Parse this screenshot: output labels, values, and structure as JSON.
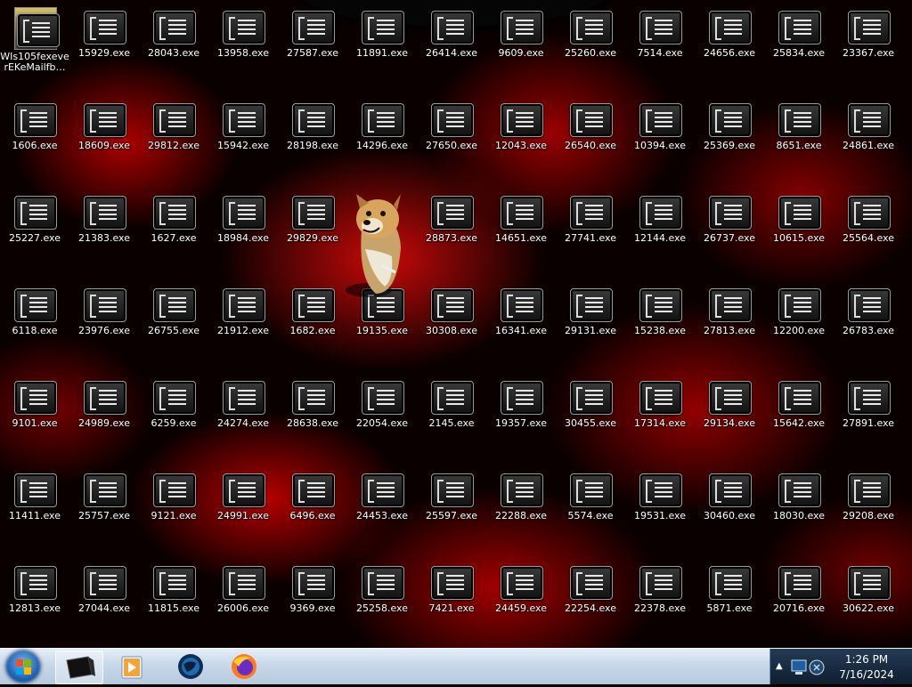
{
  "desktop": {
    "icons": [
      {
        "label": "WIs105fexeve\nrEKeMailfb…"
      },
      {
        "label": "15929.exe"
      },
      {
        "label": "28043.exe"
      },
      {
        "label": "13958.exe"
      },
      {
        "label": "27587.exe"
      },
      {
        "label": "11891.exe"
      },
      {
        "label": "26414.exe"
      },
      {
        "label": "9609.exe"
      },
      {
        "label": "25260.exe"
      },
      {
        "label": "7514.exe"
      },
      {
        "label": "24656.exe"
      },
      {
        "label": "25834.exe"
      },
      {
        "label": "23367.exe"
      },
      {
        "label": "1606.exe"
      },
      {
        "label": "18609.exe"
      },
      {
        "label": "29812.exe"
      },
      {
        "label": "15942.exe"
      },
      {
        "label": "28198.exe"
      },
      {
        "label": "14296.exe"
      },
      {
        "label": "27650.exe"
      },
      {
        "label": "12043.exe"
      },
      {
        "label": "26540.exe"
      },
      {
        "label": "10394.exe"
      },
      {
        "label": "25369.exe"
      },
      {
        "label": "8651.exe"
      },
      {
        "label": "24861.exe"
      },
      {
        "label": "25227.exe"
      },
      {
        "label": "21383.exe"
      },
      {
        "label": "1627.exe"
      },
      {
        "label": "18984.exe"
      },
      {
        "label": "29829.exe"
      },
      {
        "label": ""
      },
      {
        "label": "28873.exe"
      },
      {
        "label": "14651.exe"
      },
      {
        "label": "27741.exe"
      },
      {
        "label": "12144.exe"
      },
      {
        "label": "26737.exe"
      },
      {
        "label": "10615.exe"
      },
      {
        "label": "25564.exe"
      },
      {
        "label": "6118.exe"
      },
      {
        "label": "23976.exe"
      },
      {
        "label": "26755.exe"
      },
      {
        "label": "21912.exe"
      },
      {
        "label": "1682.exe"
      },
      {
        "label": "19135.exe"
      },
      {
        "label": "30308.exe"
      },
      {
        "label": "16341.exe"
      },
      {
        "label": "29131.exe"
      },
      {
        "label": "15238.exe"
      },
      {
        "label": "27813.exe"
      },
      {
        "label": "12200.exe"
      },
      {
        "label": "26783.exe"
      },
      {
        "label": "9101.exe"
      },
      {
        "label": "24989.exe"
      },
      {
        "label": "6259.exe"
      },
      {
        "label": "24274.exe"
      },
      {
        "label": "28638.exe"
      },
      {
        "label": "22054.exe"
      },
      {
        "label": "2145.exe"
      },
      {
        "label": "19357.exe"
      },
      {
        "label": "30455.exe"
      },
      {
        "label": "17314.exe"
      },
      {
        "label": "29134.exe"
      },
      {
        "label": "15642.exe"
      },
      {
        "label": "27891.exe"
      },
      {
        "label": "11411.exe"
      },
      {
        "label": "25757.exe"
      },
      {
        "label": "9121.exe"
      },
      {
        "label": "24991.exe"
      },
      {
        "label": "6496.exe"
      },
      {
        "label": "24453.exe"
      },
      {
        "label": "25597.exe"
      },
      {
        "label": "22288.exe"
      },
      {
        "label": "5574.exe"
      },
      {
        "label": "19531.exe"
      },
      {
        "label": "30460.exe"
      },
      {
        "label": "18030.exe"
      },
      {
        "label": "29208.exe"
      },
      {
        "label": "12813.exe"
      },
      {
        "label": "27044.exe"
      },
      {
        "label": "11815.exe"
      },
      {
        "label": "26006.exe"
      },
      {
        "label": "9369.exe"
      },
      {
        "label": "25258.exe"
      },
      {
        "label": "7421.exe"
      },
      {
        "label": "24459.exe"
      },
      {
        "label": "22254.exe"
      },
      {
        "label": "22378.exe"
      },
      {
        "label": "5871.exe"
      },
      {
        "label": "20716.exe"
      },
      {
        "label": "30622.exe"
      }
    ]
  },
  "taskbar": {
    "apps": [
      {
        "name": "terminal-app-icon"
      },
      {
        "name": "media-player-app-icon"
      },
      {
        "name": "browser-globe-app-icon"
      },
      {
        "name": "firefox-app-icon"
      }
    ],
    "clock": {
      "time": "1:26 PM",
      "date": "7/16/2024"
    }
  },
  "colors": {
    "wallpaper": "#c40000",
    "taskbar": "#c8d8ea",
    "tray": "#1a2d45"
  }
}
